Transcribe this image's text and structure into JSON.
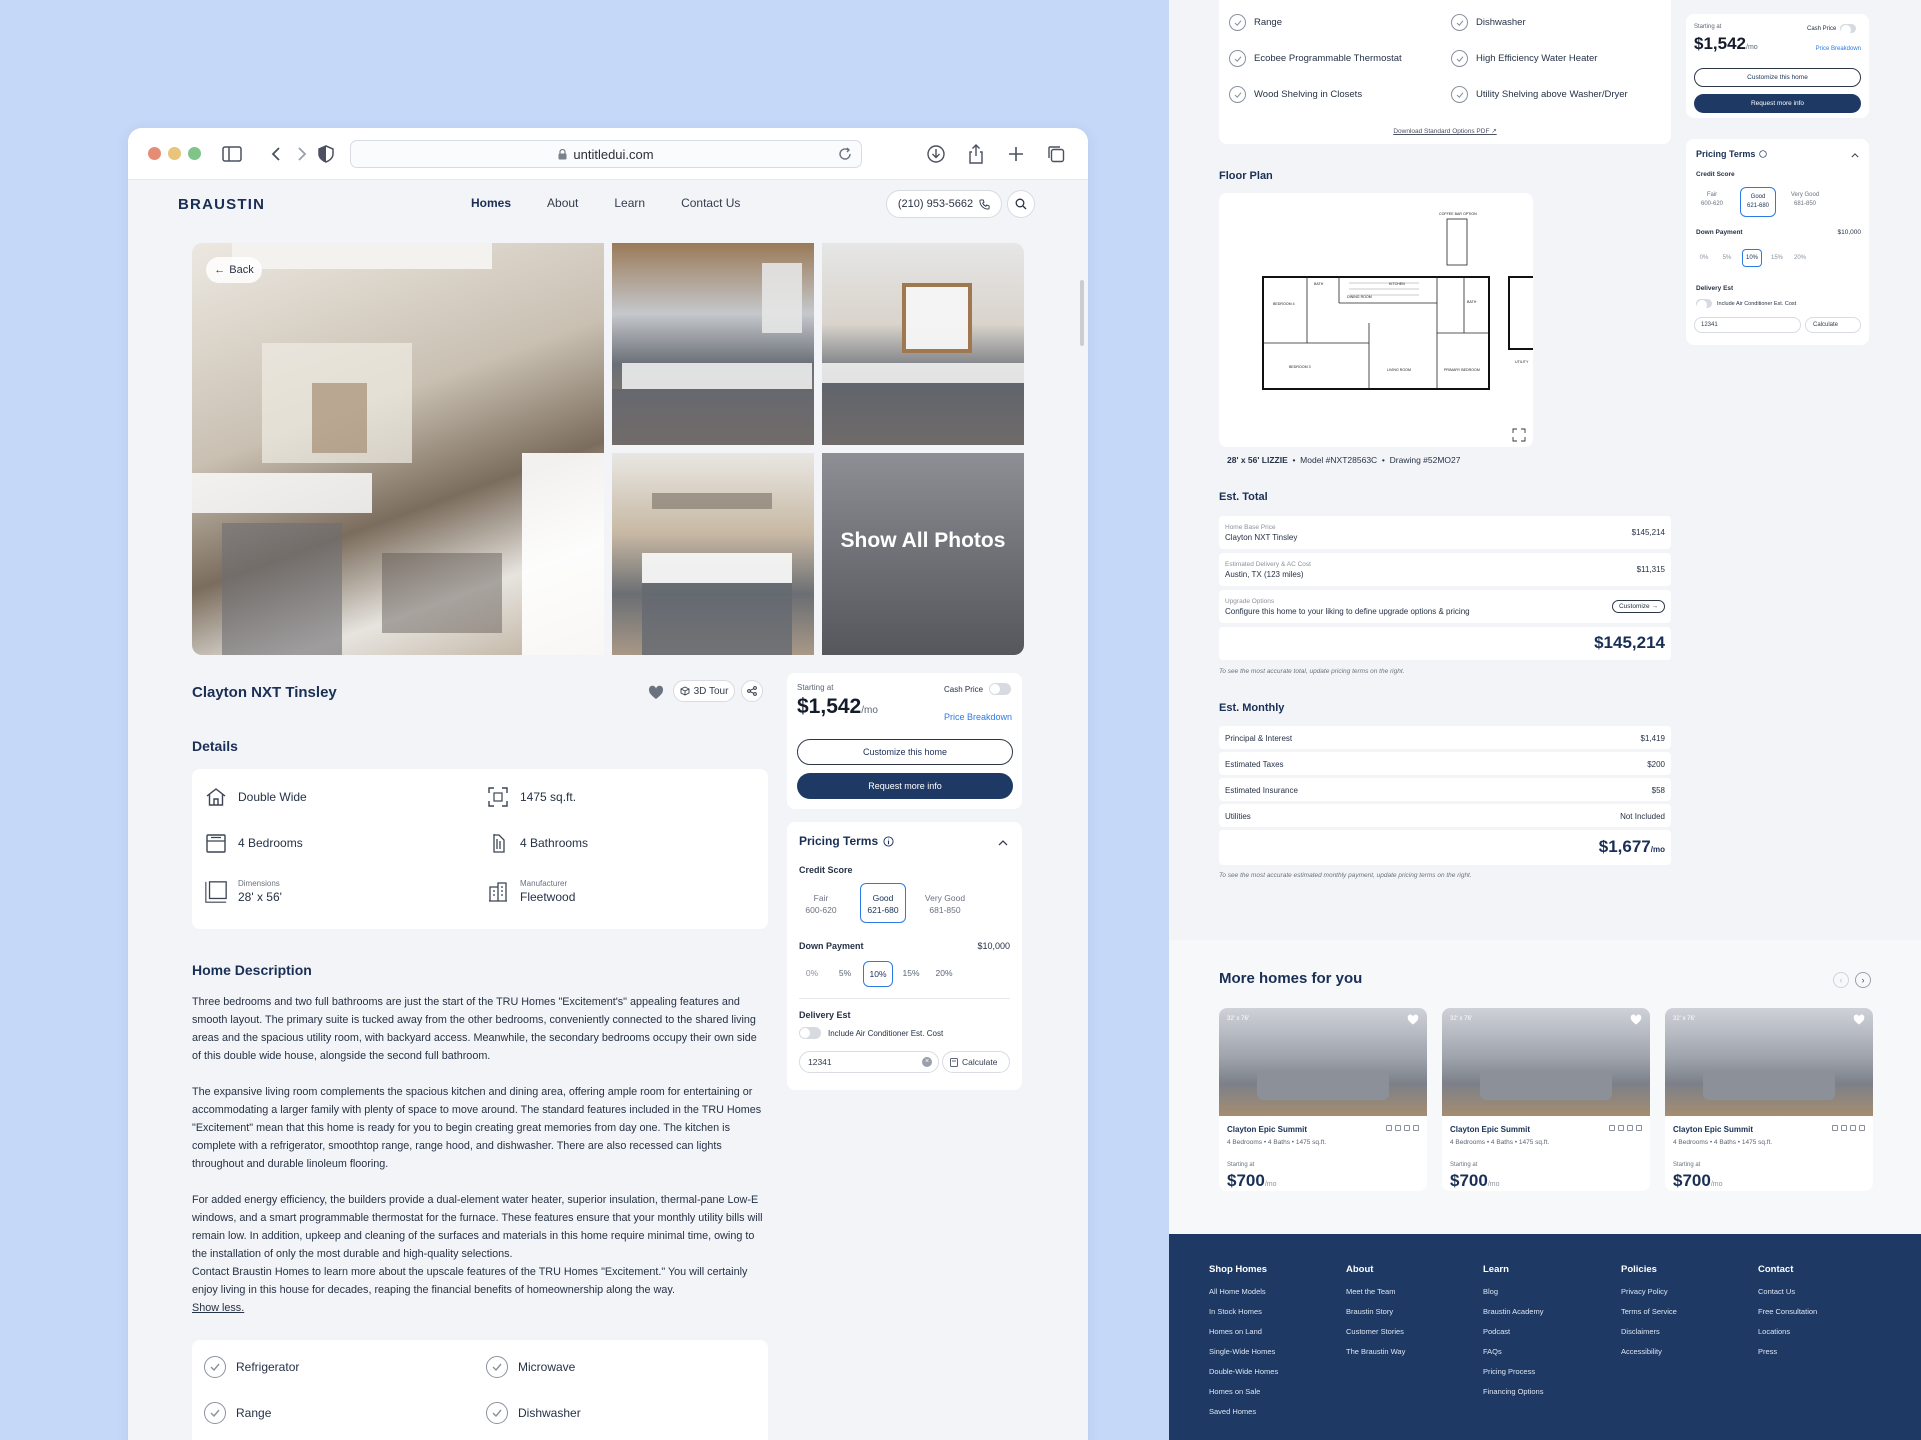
{
  "browser": {
    "url": "untitledui.com"
  },
  "site": {
    "logo": "BRAUSTIN",
    "nav": [
      "Homes",
      "About",
      "Learn",
      "Contact Us"
    ],
    "phone": "(210) 953-5662"
  },
  "gallery": {
    "back_label": "Back",
    "show_all": "Show All Photos"
  },
  "listing": {
    "title": "Clayton NXT Tinsley",
    "tour_label": "3D Tour",
    "details_heading": "Details",
    "details": [
      {
        "label": "",
        "value": "Double Wide",
        "icon": "home-icon"
      },
      {
        "label": "",
        "value": "1475 sq.ft.",
        "icon": "area-icon"
      },
      {
        "label": "",
        "value": "4 Bedrooms",
        "icon": "bed-icon"
      },
      {
        "label": "",
        "value": "4 Bathrooms",
        "icon": "shower-icon"
      },
      {
        "label": "Dimensions",
        "value": "28' x 56'",
        "icon": "dimensions-icon"
      },
      {
        "label": "Manufacturer",
        "value": "Fleetwood",
        "icon": "building-icon"
      }
    ],
    "description_heading": "Home Description",
    "description": [
      "Three bedrooms and two full bathrooms are just the start of the TRU Homes \"Excitement's\" appealing features and smooth layout. The primary suite is tucked away from the other bedrooms, conveniently connected to the shared living areas and the spacious utility room, with backyard access. Meanwhile, the secondary bedrooms occupy their own side of this double wide house, alongside the second full bathroom.",
      "The expansive living room complements the spacious kitchen and dining area, offering ample room for entertaining or accommodating a larger family with plenty of space to move around. The standard features included in the TRU Homes \"Excitement\" mean that this home is ready for you to begin creating great memories from day one. The kitchen is complete with a refrigerator, smoothtop range, range hood, and dishwasher. There are also recessed can lights throughout and durable linoleum flooring.",
      "For added energy efficiency, the builders provide a dual-element water heater, superior insulation, thermal-pane Low-E windows, and a smart programmable thermostat for the furnace. These features ensure that your monthly utility bills will remain low. In addition, upkeep and cleaning of the surfaces and materials in this home require minimal time, owing to the installation of only the most durable and high-quality selections.",
      "Contact Braustin Homes to learn more about the upscale features of the TRU Homes \"Excitement.\" You will certainly enjoy living in this house for decades, reaping the financial benefits of homeownership along the way."
    ],
    "show_less": "Show less.",
    "features": [
      "Refrigerator",
      "Microwave",
      "Range",
      "Dishwasher"
    ]
  },
  "price_card": {
    "starting_label": "Starting at",
    "price": "$1,542",
    "per": "/mo",
    "cash_label": "Cash Price",
    "breakdown_label": "Price Breakdown",
    "customize_label": "Customize this home",
    "request_label": "Request more info"
  },
  "pricing_terms": {
    "title": "Pricing Terms",
    "credit_label": "Credit Score",
    "credit_options": [
      {
        "name": "Fair",
        "range": "600-620"
      },
      {
        "name": "Good",
        "range": "621-680"
      },
      {
        "name": "Very Good",
        "range": "681-850"
      }
    ],
    "down_label": "Down Payment",
    "down_value": "$10,000",
    "down_options": [
      "0%",
      "5%",
      "10%",
      "15%",
      "20%"
    ],
    "delivery_label": "Delivery Est",
    "ac_label": "Include Air Conditioner Est. Cost",
    "zip": "12341",
    "calc_label": "Calculate"
  },
  "right": {
    "features": [
      "Range",
      "Dishwasher",
      "Ecobee Programmable Thermostat",
      "High Efficiency Water Heater",
      "Wood Shelving in Closets",
      "Utility Shelving above Washer/Dryer"
    ],
    "download_label": "Download Standard Options PDF",
    "floor_plan_heading": "Floor Plan",
    "floor_plan_name": "28' x 56' LIZZIE",
    "floor_plan_model": "Model #NXT28563C",
    "floor_plan_drawing": "Drawing #52MO27",
    "floor_plan_rooms": [
      "COFFEE BAR OPTION",
      "BEDROOM 4",
      "BATH",
      "DINING ROOM",
      "KITCHEN",
      "BATH",
      "BEDROOM 3",
      "LIVING ROOM",
      "PRIMARY BEDROOM",
      "UTILITY"
    ],
    "est_total_heading": "Est. Total",
    "est_total_rows": [
      {
        "small": "Home Base Price",
        "label": "Clayton NXT Tinsley",
        "value": "$145,214"
      },
      {
        "small": "Estimated Delivery & AC Cost",
        "label": "Austin, TX (123 miles)",
        "value": "$11,315"
      },
      {
        "small": "Upgrade Options",
        "label": "Configure this home to your liking to define upgrade options & pricing",
        "value": "Customize"
      }
    ],
    "est_total_value": "$145,214",
    "est_total_note": "To see the most accurate total, update pricing terms on the right.",
    "est_monthly_heading": "Est. Monthly",
    "est_monthly_rows": [
      {
        "label": "Principal & Interest",
        "value": "$1,419"
      },
      {
        "label": "Estimated Taxes",
        "value": "$200"
      },
      {
        "label": "Estimated Insurance",
        "value": "$58"
      },
      {
        "label": "Utilities",
        "value": "Not Included"
      }
    ],
    "est_monthly_value": "$1,677",
    "est_monthly_per": "/mo",
    "est_monthly_note": "To see the most accurate estimated monthly payment, update pricing terms on the right.",
    "more_heading": "More homes for you",
    "homes": [
      {
        "tag": "32' x 76'",
        "name": "Clayton Epic Summit",
        "specs": "4 Bedrooms • 4 Baths • 1475 sq.ft.",
        "starting": "Starting at",
        "price": "$700",
        "per": "/mo"
      },
      {
        "tag": "32' x 76'",
        "name": "Clayton Epic Summit",
        "specs": "4 Bedrooms • 4 Baths • 1475 sq.ft.",
        "starting": "Starting at",
        "price": "$700",
        "per": "/mo"
      },
      {
        "tag": "32' x 76'",
        "name": "Clayton Epic Summit",
        "specs": "4 Bedrooms • 4 Baths • 1475 sq.ft.",
        "starting": "Starting at",
        "price": "$700",
        "per": "/mo"
      }
    ]
  },
  "footer": {
    "columns": [
      {
        "heading": "Shop Homes",
        "items": [
          "All Home Models",
          "In Stock Homes",
          "Homes on Land",
          "Single-Wide Homes",
          "Double-Wide Homes",
          "Homes on Sale",
          "Saved Homes"
        ]
      },
      {
        "heading": "About",
        "items": [
          "Meet the Team",
          "Braustin Story",
          "Customer Stories",
          "The Braustin Way"
        ]
      },
      {
        "heading": "Learn",
        "items": [
          "Blog",
          "Braustin Academy",
          "Podcast",
          "FAQs",
          "Pricing Process",
          "Financing Options"
        ]
      },
      {
        "heading": "Policies",
        "items": [
          "Privacy Policy",
          "Terms of Service",
          "Disclaimers",
          "Accessibility"
        ]
      },
      {
        "heading": "Contact",
        "items": [
          "Contact Us",
          "Free Consultation",
          "Locations",
          "Press"
        ]
      }
    ]
  }
}
